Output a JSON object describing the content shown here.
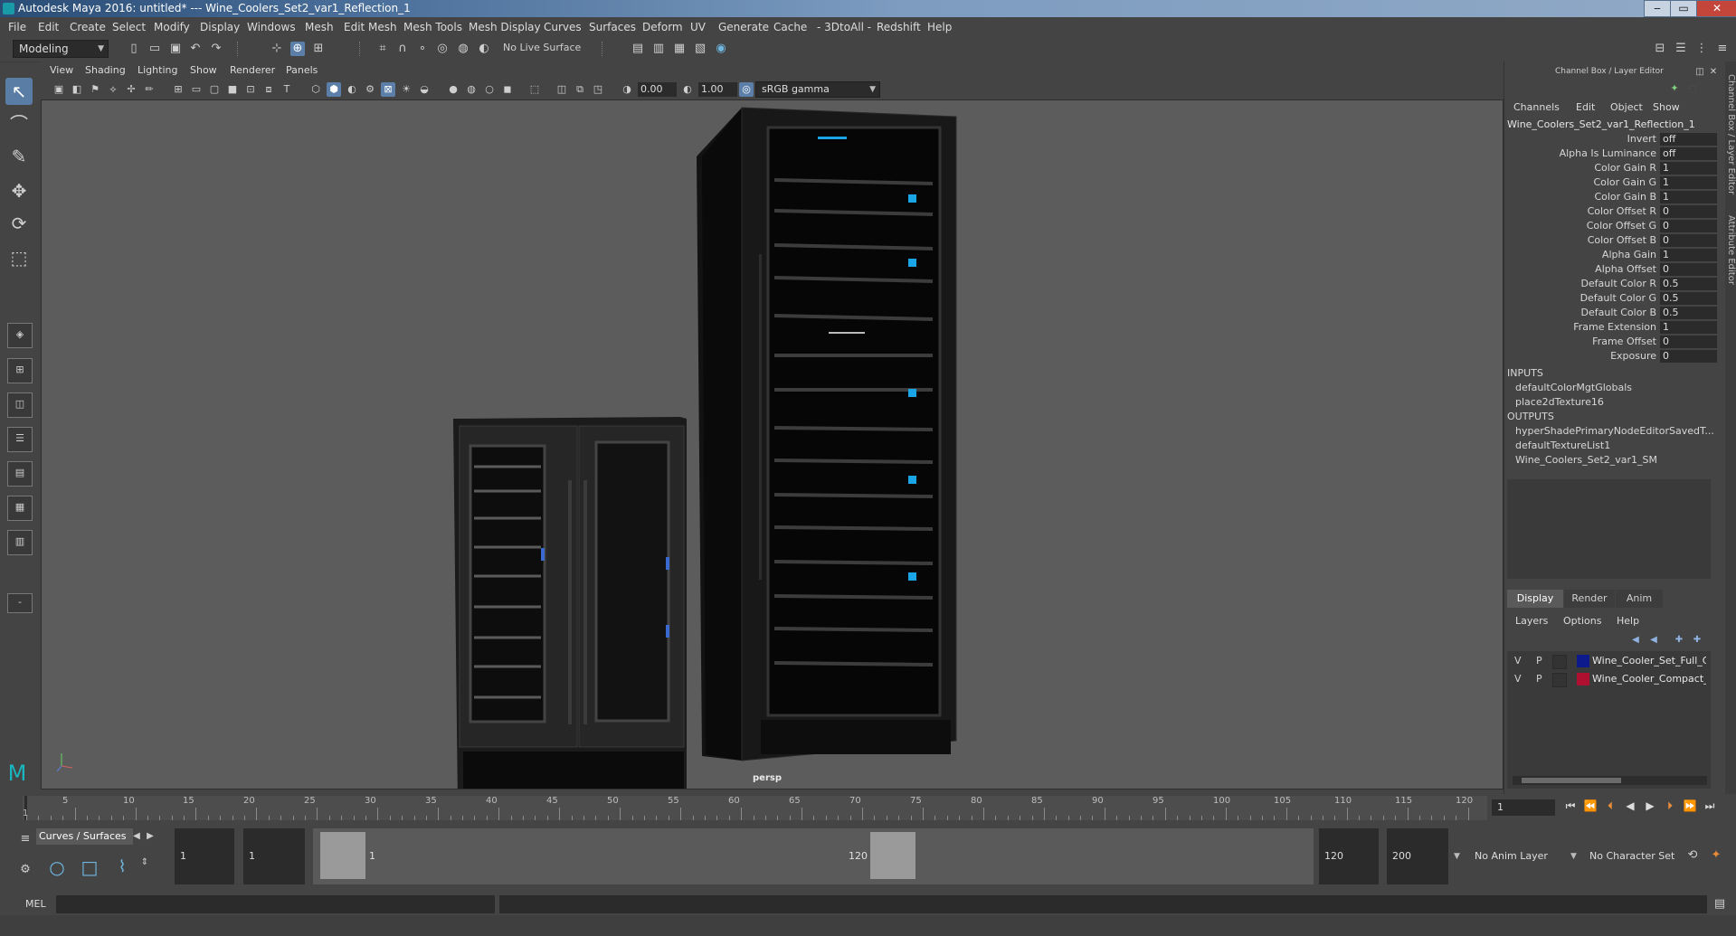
{
  "window": {
    "title": "Autodesk Maya 2016: untitled*   ---   Wine_Coolers_Set2_var1_Reflection_1",
    "controls": [
      "‒",
      "▭",
      "✕"
    ]
  },
  "menubar": [
    "File",
    "Edit",
    "Create",
    "Select",
    "Modify",
    "Display",
    "Windows",
    "Mesh",
    "Edit Mesh",
    "Mesh Tools",
    "Mesh Display",
    "Curves",
    "Surfaces",
    "Deform",
    "UV",
    "Generate",
    "Cache",
    "- 3DtoAll -",
    "Redshift",
    "Help"
  ],
  "status": {
    "mode": "Modeling",
    "live_surface": "No Live Surface"
  },
  "viewport": {
    "menu": [
      "View",
      "Shading",
      "Lighting",
      "Show",
      "Renderer",
      "Panels"
    ],
    "exposure": "0.00",
    "gamma": "1.00",
    "color_space": "sRGB gamma",
    "camera_label": "persp"
  },
  "channel_box": {
    "header": "Channel Box / Layer Editor",
    "menu": [
      "Channels",
      "Edit",
      "Object",
      "Show"
    ],
    "node": "Wine_Coolers_Set2_var1_Reflection_1",
    "attributes": [
      {
        "label": "Invert",
        "value": "off"
      },
      {
        "label": "Alpha Is Luminance",
        "value": "off"
      },
      {
        "label": "Color Gain R",
        "value": "1"
      },
      {
        "label": "Color Gain G",
        "value": "1"
      },
      {
        "label": "Color Gain B",
        "value": "1"
      },
      {
        "label": "Color Offset R",
        "value": "0"
      },
      {
        "label": "Color Offset G",
        "value": "0"
      },
      {
        "label": "Color Offset B",
        "value": "0"
      },
      {
        "label": "Alpha Gain",
        "value": "1"
      },
      {
        "label": "Alpha Offset",
        "value": "0"
      },
      {
        "label": "Default Color R",
        "value": "0.5"
      },
      {
        "label": "Default Color G",
        "value": "0.5"
      },
      {
        "label": "Default Color B",
        "value": "0.5"
      },
      {
        "label": "Frame Extension",
        "value": "1"
      },
      {
        "label": "Frame Offset",
        "value": "0"
      },
      {
        "label": "Exposure",
        "value": "0"
      }
    ],
    "inputs_label": "INPUTS",
    "inputs": [
      "defaultColorMgtGlobals",
      "place2dTexture16"
    ],
    "outputs_label": "OUTPUTS",
    "outputs": [
      "hyperShadePrimaryNodeEditorSavedT...",
      "defaultTextureList1",
      "Wine_Coolers_Set2_var1_SM"
    ]
  },
  "layer_editor": {
    "tabs": [
      "Display",
      "Render",
      "Anim"
    ],
    "menu": [
      "Layers",
      "Options",
      "Help"
    ],
    "layers": [
      {
        "v": "V",
        "p": "P",
        "color": "#0d1a8c",
        "name": "Wine_Cooler_Set_Full_C"
      },
      {
        "v": "V",
        "p": "P",
        "color": "#b01030",
        "name": "Wine_Cooler_Compact_D"
      }
    ]
  },
  "side_tabs": [
    "Channel Box / Layer Editor",
    "Attribute Editor"
  ],
  "timeline": {
    "ticks": [
      5,
      10,
      15,
      20,
      25,
      30,
      35,
      40,
      45,
      50,
      55,
      60,
      65,
      70,
      75,
      80,
      85,
      90,
      95,
      100,
      105,
      110,
      115,
      120
    ],
    "current_marker": "1",
    "current_frame": "1"
  },
  "range": {
    "shelf_tab": "Curves / Surfaces",
    "start": "1",
    "playback_start": "1",
    "range_start_label": "1",
    "range_end_label": "120",
    "playback_end": "120",
    "end": "200",
    "anim_layer": "No Anim Layer",
    "character_set": "No Character Set"
  },
  "command": {
    "lang": "MEL"
  }
}
